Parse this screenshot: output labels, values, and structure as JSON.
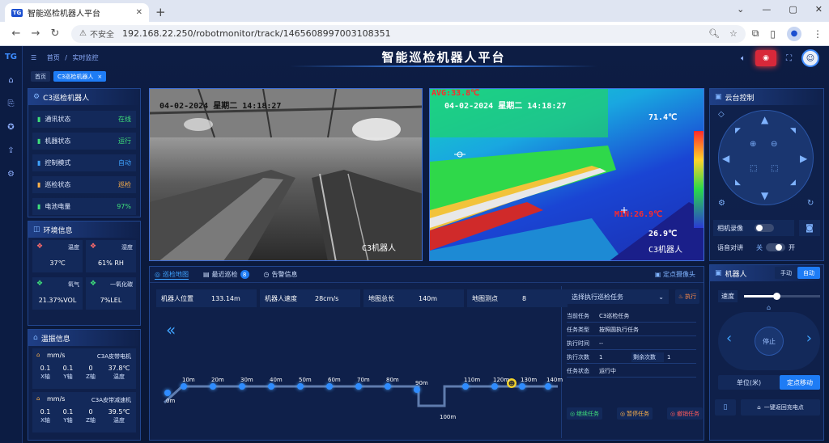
{
  "browser": {
    "tab_title": "智能巡检机器人平台",
    "favicon": "TG",
    "url": "192.168.22.250/robotmonitor/track/1465608997003108351",
    "not_secure": "不安全"
  },
  "app": {
    "title": "智能巡检机器人平台",
    "breadcrumb_home": "首页",
    "breadcrumb_sep": "/",
    "breadcrumb_current": "实时监控",
    "logo": "TG"
  },
  "page_tabs": [
    "首页",
    "C3巡检机器人"
  ],
  "robot": {
    "title": "C3巡检机器人",
    "status": [
      {
        "label": "通讯状态",
        "value": "在线",
        "color": "#3fe07a",
        "icon": "signal-icon"
      },
      {
        "label": "机器状态",
        "value": "运行",
        "color": "#3fe07a",
        "icon": "robot-icon"
      },
      {
        "label": "控制模式",
        "value": "自动",
        "color": "#3fa3ff",
        "icon": "control-icon"
      },
      {
        "label": "巡检状态",
        "value": "巡检",
        "color": "#ffb24a",
        "icon": "patrol-icon"
      },
      {
        "label": "电池电量",
        "value": "97%",
        "color": "#3fe07a",
        "icon": "battery-icon"
      }
    ]
  },
  "environment": {
    "title": "环境信息",
    "items": [
      {
        "name": "温度",
        "value": "37℃",
        "icon": "thermometer-icon"
      },
      {
        "name": "湿度",
        "value": "61% RH",
        "icon": "humidity-icon"
      },
      {
        "name": "氧气",
        "value": "21.37%VOL",
        "icon": "oxygen-icon"
      },
      {
        "name": "一氧化碳",
        "value": "7%LEL",
        "icon": "co-icon"
      }
    ]
  },
  "vibration": {
    "title": "温振信息",
    "cards": [
      {
        "unit": "mm/s",
        "device": "C3A皮带电机",
        "x": "0.1",
        "y": "0.1",
        "z": "0",
        "temp": "37.8℃"
      },
      {
        "unit": "mm/s",
        "device": "C3A皮带减速机",
        "x": "0.1",
        "y": "0.1",
        "z": "0",
        "temp": "39.5℃"
      }
    ],
    "x_label": "X轴",
    "y_label": "Y轴",
    "z_label": "Z轴",
    "temp_label": "温度"
  },
  "videos": {
    "visible": {
      "timestamp": "04-02-2024 星期二 14:18:27",
      "label": "C3机器人"
    },
    "thermal": {
      "avg": "AVG:33.8℃",
      "timestamp": "04-02-2024 星期二 14:18:27",
      "max": "71.4℃",
      "min": "MIN:26.9℃",
      "current": "26.9℃",
      "label": "C3机器人"
    }
  },
  "bottom": {
    "tabs": [
      "巡检地图",
      "最近巡检",
      "告警信息"
    ],
    "recent_badge": "8",
    "camera_link": "定点摄像头",
    "info": [
      {
        "label": "机器人位置",
        "value": "133.14m"
      },
      {
        "label": "机器人速度",
        "value": "28cm/s"
      },
      {
        "label": "地图总长",
        "value": "140m"
      },
      {
        "label": "地图测点",
        "value": "8"
      }
    ],
    "map_marks": [
      "0m",
      "10m",
      "20m",
      "30m",
      "40m",
      "50m",
      "60m",
      "70m",
      "80m",
      "90m",
      "100m",
      "110m",
      "120m",
      "130m",
      "140m"
    ]
  },
  "task": {
    "select_placeholder": "选择执行巡检任务",
    "execute": "执行",
    "rows": [
      {
        "k": "当前任务",
        "v": "C3巡检任务"
      },
      {
        "k": "任务类型",
        "v": "按照圆执行任务"
      },
      {
        "k": "执行时间",
        "v": "--"
      },
      {
        "k": "执行次数",
        "v": "1",
        "k2": "剩余次数",
        "v2": "1"
      },
      {
        "k": "任务状态",
        "v": "运行中"
      }
    ],
    "btn_continue": "继续任务",
    "btn_pause": "暂停任务",
    "btn_cancel": "撤销任务"
  },
  "ptz": {
    "title": "云台控制",
    "camera_record": "相机录像",
    "voice_talk": "语音对讲",
    "off": "关",
    "on": "开"
  },
  "robot_ctrl": {
    "title": "机器人",
    "manual": "手动",
    "auto": "自动",
    "speed_label": "速度",
    "stop": "停止",
    "unit_label": "单位(米)",
    "fixed_move": "定点移动",
    "return_charge": "一键返回充电点"
  },
  "colors": {
    "accent": "#1e7cf5",
    "bg": "#0b1a3a",
    "panel": "#10224e",
    "green": "#3fe07a",
    "orange": "#ffb24a"
  }
}
